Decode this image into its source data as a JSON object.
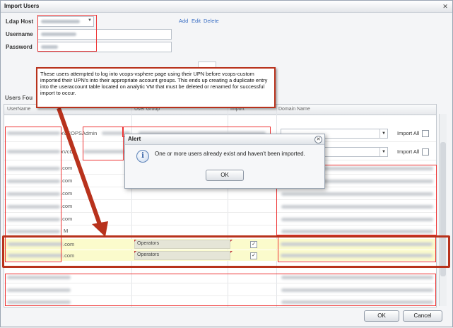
{
  "window": {
    "title": "Import Users"
  },
  "form": {
    "ldap_host_label": "Ldap Host",
    "username_label": "Username",
    "password_label": "Password",
    "add_link": "Add",
    "edit_link": "Edit",
    "delete_link": "Delete"
  },
  "users_section": {
    "title": "Users Fou"
  },
  "grid": {
    "columns": [
      "UserName",
      "User Group",
      "Import",
      "Domain Name"
    ],
    "rows": [
      {
        "user_suffix": "xVCOPSAdmin",
        "import_all": "Import All"
      },
      {
        "user_suffix": "xVcO",
        "import_all": "Import All"
      },
      {
        "user_suffix": ".com"
      },
      {
        "user_suffix": ".com"
      },
      {
        "user_suffix": ".com"
      },
      {
        "user_suffix": ".com"
      },
      {
        "user_suffix": ".com"
      },
      {
        "user_suffix": "M"
      },
      {
        "user_suffix": ".com",
        "group": "Operators",
        "import": "checked"
      },
      {
        "user_suffix": ".com",
        "group": "Operators",
        "import": "checked"
      }
    ]
  },
  "callout": {
    "text": "These users attempted to log into vcops-vsphere page using their UPN before vcops-custom imported their UPN's into their appropriate account groups.  This ends up creating a duplicate entry into the useraccount table located on analytic VM that must be deleted or renamed for successful import to occur."
  },
  "alert": {
    "title": "Alert",
    "message": "One or more users already exist and haven't been imported.",
    "ok_label": "OK"
  },
  "footer": {
    "ok_label": "OK",
    "cancel_label": "Cancel"
  },
  "colors": {
    "annotation_red": "#b8321c",
    "highlight_yellow": "#fbfbcc",
    "link_blue": "#3b6fc4"
  }
}
